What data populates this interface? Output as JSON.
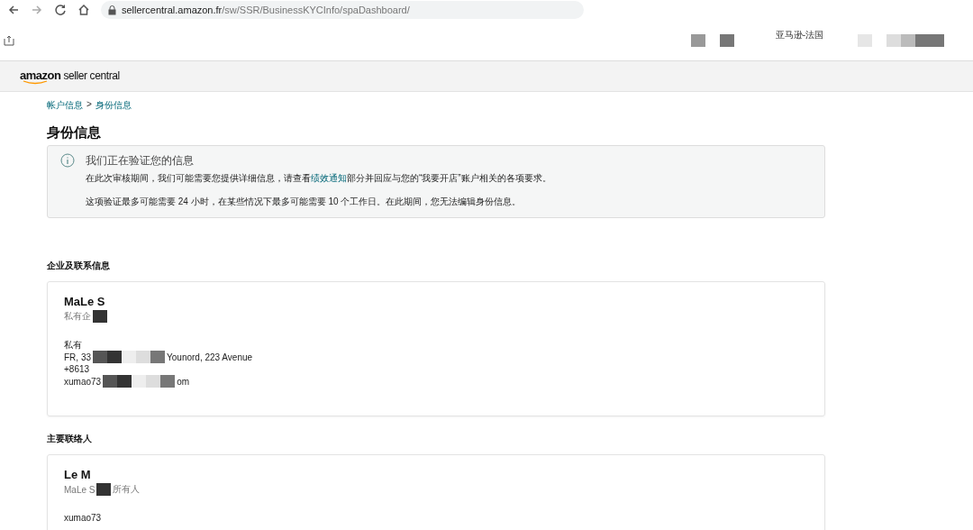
{
  "browser": {
    "url_host": "sellercentral.amazon.fr",
    "url_path": "/sw/SSR/BusinessKYCInfo/spaDashboard/"
  },
  "header": {
    "marketplace": "亚马逊-法国",
    "logo_brand": "amazon",
    "logo_product": "seller central"
  },
  "breadcrumb": {
    "items": [
      {
        "label": "帐户信息"
      },
      {
        "label": "身份信息"
      }
    ],
    "separator": ">"
  },
  "page_title": "身份信息",
  "alert": {
    "title": "我们正在验证您的信息",
    "body_before": "在此次审核期间，我们可能需要您提供详细信息，请查看",
    "link": "绩效通知",
    "body_after": "部分并回应与您的“我要开店”账户相关的各项要求。",
    "note": "这项验证最多可能需要 24 小时，在某些情况下最多可能需要 10 个工作日。在此期间，您无法编辑身份信息。"
  },
  "sections": [
    {
      "heading": "企业及联系信息",
      "card": {
        "name": [
          "MaLe S"
        ],
        "subtitle": [
          "私有企"
        ],
        "lines": [
          [
            "私有"
          ],
          [
            "FR, 33",
            "Younord, 223 Avenue"
          ],
          [
            "+8613"
          ],
          [
            "xumao73",
            "om"
          ]
        ]
      }
    },
    {
      "heading": "主要联络人",
      "card": {
        "name": [
          "Le M"
        ],
        "subtitle": [
          "MaLe S",
          "所有人"
        ],
        "lines": [
          [
            "xumao73"
          ]
        ]
      }
    }
  ]
}
